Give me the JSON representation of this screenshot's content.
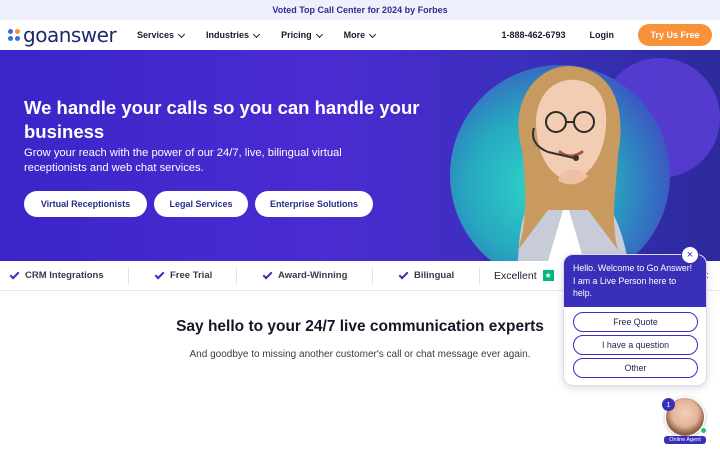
{
  "topbar": {
    "text": "Voted Top Call Center for 2024 by Forbes"
  },
  "logo": {
    "part1": "go",
    "part2": "answer",
    "dot_colors": [
      "#3a6fd8",
      "#f7913a",
      "#3a6fd8",
      "#3a6fd8"
    ]
  },
  "nav": {
    "items": [
      {
        "label": "Services"
      },
      {
        "label": "Industries"
      },
      {
        "label": "Pricing"
      },
      {
        "label": "More"
      }
    ],
    "phone": "1-888-462-6793",
    "login": "Login",
    "cta": "Try Us Free"
  },
  "hero": {
    "title": "We handle your calls so you can handle your business",
    "subtitle": "Grow your reach with the power of our 24/7, live, bilingual virtual receptionists and web chat services.",
    "buttons": [
      {
        "label": "Virtual Receptionists"
      },
      {
        "label": "Legal Services"
      },
      {
        "label": "Enterprise Solutions"
      }
    ]
  },
  "badges": {
    "items": [
      {
        "label": "CRM Integrations"
      },
      {
        "label": "Free Trial"
      },
      {
        "label": "Award-Winning"
      },
      {
        "label": "Bilingual"
      }
    ],
    "rating_label": "Excellent",
    "partial_text": "t"
  },
  "section": {
    "title": "Say hello to your 24/7 live communication experts",
    "subtitle": "And goodbye to missing another customer's call or chat message ever again."
  },
  "chat": {
    "message": "Hello. Welcome to Go Answer! I am a Live Person here to help.",
    "close": "×",
    "options": [
      {
        "label": "Free Quote"
      },
      {
        "label": "I have a question"
      },
      {
        "label": "Other"
      }
    ]
  },
  "agent": {
    "count": "1",
    "label": "Online Agent"
  },
  "colors": {
    "accent": "#3a2fb9",
    "cta": "#f7913a",
    "trustpilot": "#00b67a"
  }
}
